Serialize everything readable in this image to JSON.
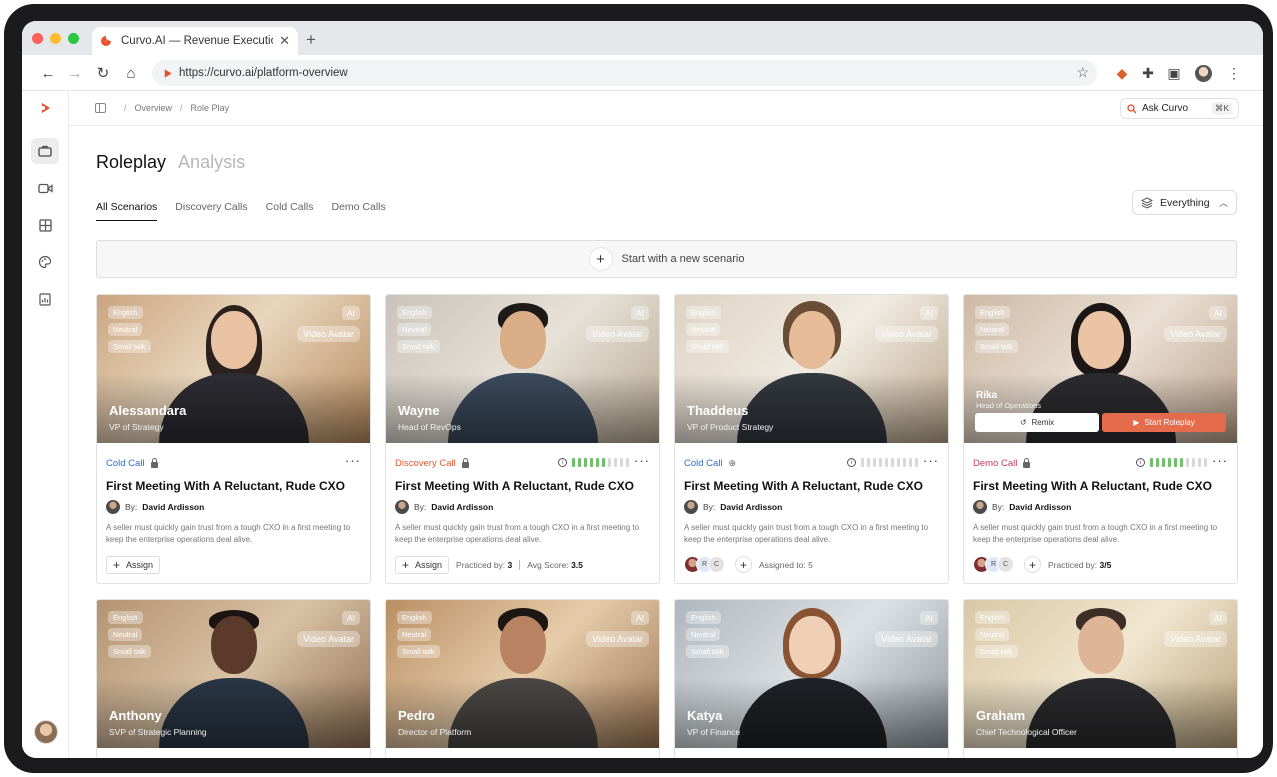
{
  "browser": {
    "tab_title": "Curvo.AI — Revenue Executio...",
    "url": "https://curvo.ai/platform-overview",
    "traffic_colors": [
      "#ff5f57",
      "#febc2e",
      "#28c840"
    ]
  },
  "breadcrumb": {
    "overview": "Overview",
    "sep": "/",
    "current": "Role Play"
  },
  "ask": {
    "label": "Ask Curvo",
    "shortcut": "⌘K"
  },
  "heading": {
    "active": "Roleplay",
    "inactive": "Analysis"
  },
  "subtabs": [
    "All Scenarios",
    "Discovery Calls",
    "Cold Calls",
    "Demo Calls"
  ],
  "filter": {
    "label": "Everything"
  },
  "new_scenario": {
    "label": "Start with a new scenario"
  },
  "card_common": {
    "chips": [
      "English",
      "Neutral",
      "Small talk"
    ],
    "ai": "AI",
    "video": "Video Avatar",
    "title": "First Meeting With A Reluctant, Rude CXO",
    "by": "By:",
    "author": "David Ardisson",
    "desc": "A seller must quickly gain trust from a tough CXO in a first meeting to keep the enterprise operations deal alive.",
    "assign": "Assign",
    "more": "···"
  },
  "cards": [
    {
      "name": "Alessandara",
      "role": "VP of Strategy",
      "type": "Cold Call"
    },
    {
      "name": "Wayne",
      "role": "Head of RevOps",
      "type": "Discovery Call",
      "practiced_label": "Practiced by:",
      "practiced": "3",
      "avg_label": "Avg Score:",
      "avg": "3.5",
      "meter": 0.6
    },
    {
      "name": "Thaddeus",
      "role": "VP of Product Strategy",
      "type": "Cold Call",
      "assigned": "Assigned to: 5",
      "av_r": "R",
      "av_c": "C",
      "meter": 0
    },
    {
      "name": "Rika",
      "role": "Head of Operations",
      "type": "Demo Call",
      "remix": "Remix",
      "start": "Start Roleplay",
      "practiced_label": "Practiced by:",
      "practiced": "3/5",
      "av_r": "R",
      "av_c": "C",
      "meter": 0.6
    },
    {
      "name": "Anthony",
      "role": "SVP of Strategic Planning"
    },
    {
      "name": "Pedro",
      "role": "Director of Platform"
    },
    {
      "name": "Katya",
      "role": "VP of Finance"
    },
    {
      "name": "Graham",
      "role": "Chief Technological Officer"
    }
  ]
}
